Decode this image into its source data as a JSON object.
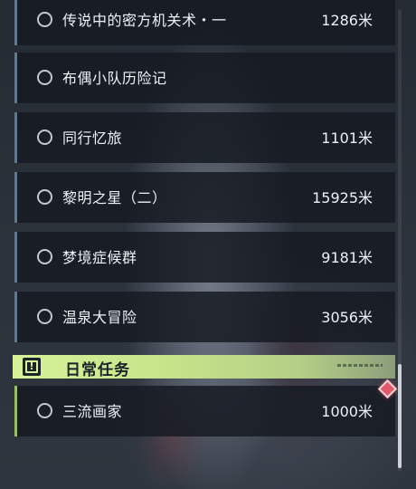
{
  "quests": [
    {
      "name": "传说中的密方机关术・一",
      "distance": "1286米"
    },
    {
      "name": "布偶小队历险记",
      "distance": ""
    },
    {
      "name": "同行忆旅",
      "distance": "1101米"
    },
    {
      "name": "黎明之星（二）",
      "distance": "15925米"
    },
    {
      "name": "梦境症候群",
      "distance": "9181米"
    },
    {
      "name": "温泉大冒险",
      "distance": "3056米"
    }
  ],
  "daily_section": {
    "title": "日常任务",
    "icon": "exclamation-icon",
    "accent_color": "#d7f39a",
    "items": [
      {
        "name": "三流画家",
        "distance": "1000米"
      }
    ]
  },
  "colors": {
    "row_accent": "#62798c",
    "daily_accent": "#9bbf67",
    "marker": "#e25a6a"
  }
}
